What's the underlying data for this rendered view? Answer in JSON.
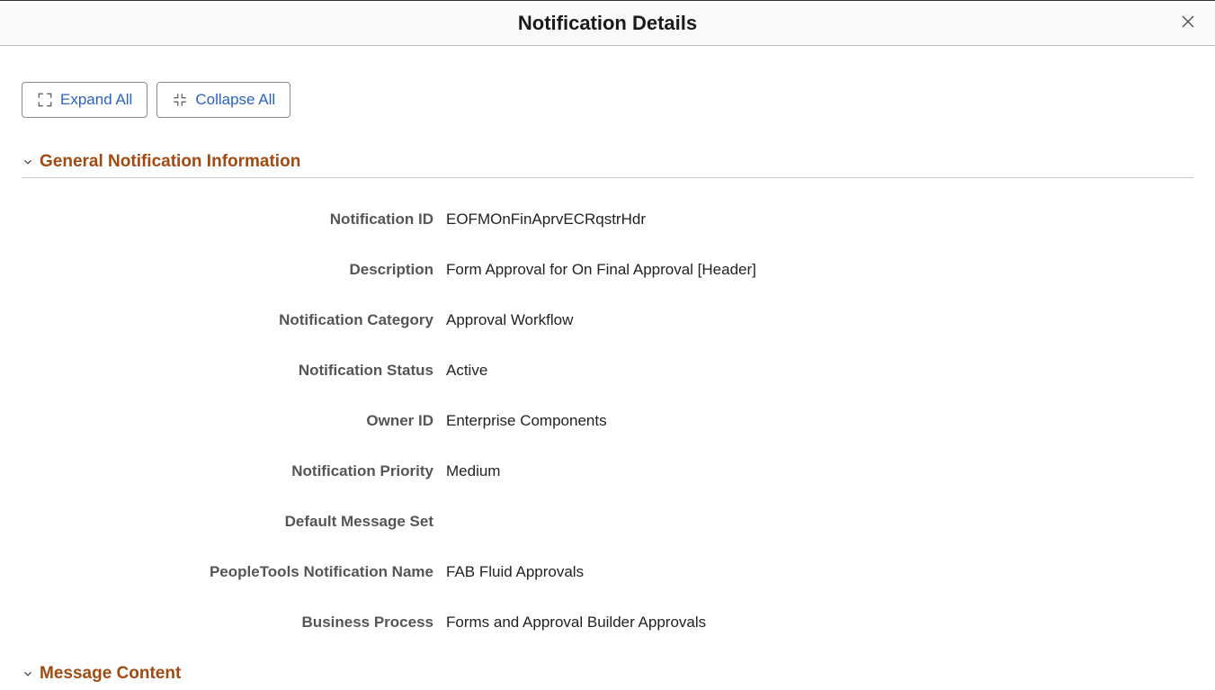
{
  "header": {
    "title": "Notification Details"
  },
  "toolbar": {
    "expand_label": "Expand All",
    "collapse_label": "Collapse All"
  },
  "sections": {
    "general": {
      "title": "General Notification Information",
      "fields": {
        "notification_id": {
          "label": "Notification ID",
          "value": "EOFMOnFinAprvECRqstrHdr"
        },
        "description": {
          "label": "Description",
          "value": "Form Approval for On Final Approval [Header]"
        },
        "notification_category": {
          "label": "Notification Category",
          "value": "Approval Workflow"
        },
        "notification_status": {
          "label": "Notification Status",
          "value": "Active"
        },
        "owner_id": {
          "label": "Owner ID",
          "value": "Enterprise Components"
        },
        "notification_priority": {
          "label": "Notification Priority",
          "value": "Medium"
        },
        "default_message_set": {
          "label": "Default Message Set",
          "value": ""
        },
        "peopletools_notification_name": {
          "label": "PeopleTools Notification Name",
          "value": "FAB Fluid Approvals"
        },
        "business_process": {
          "label": "Business Process",
          "value": "Forms and Approval Builder Approvals"
        }
      }
    },
    "message_content": {
      "title": "Message Content"
    }
  }
}
